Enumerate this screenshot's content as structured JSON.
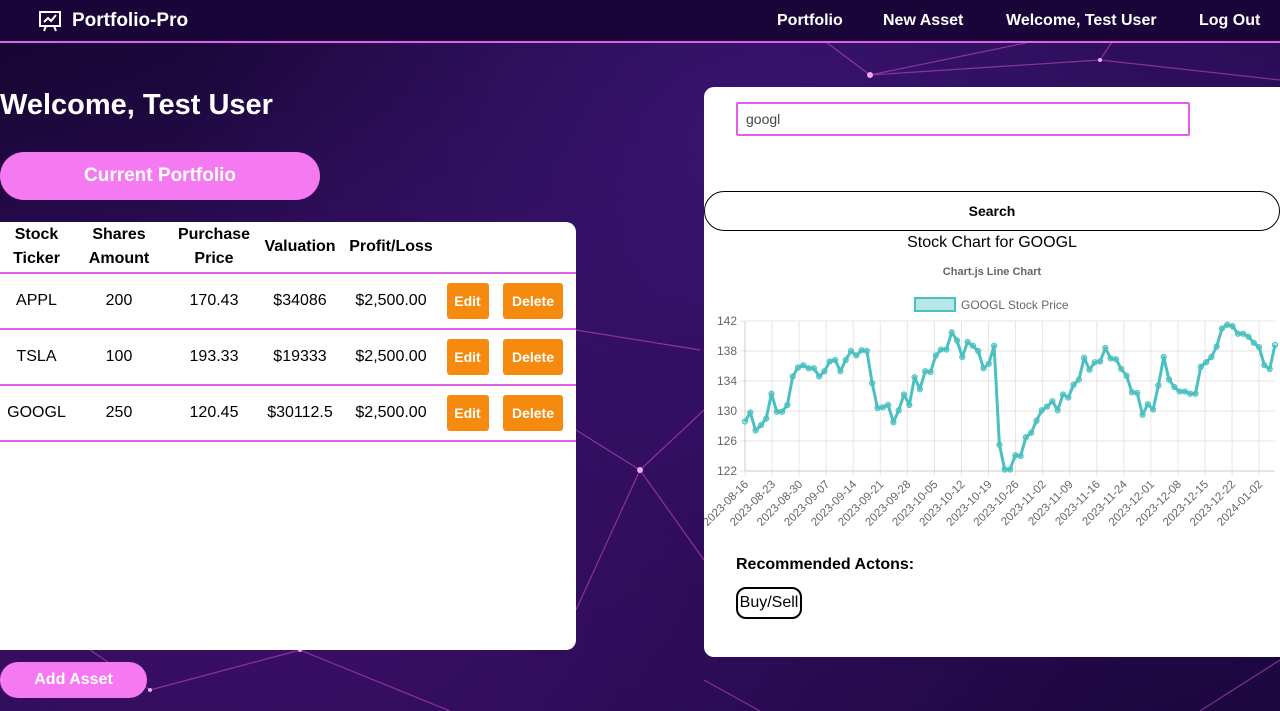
{
  "nav": {
    "brand": "Portfolio-Pro",
    "links": [
      "Portfolio",
      "New Asset",
      "Welcome, Test User",
      "Log Out"
    ]
  },
  "main": {
    "welcome": "Welcome, Test User",
    "current_portfolio_button": "Current Portfolio",
    "add_asset_button": "Add Asset"
  },
  "table": {
    "headers": [
      [
        "Stock",
        "Ticker"
      ],
      [
        "Shares",
        "Amount"
      ],
      [
        "Purchase",
        "Price"
      ],
      [
        "Valuation"
      ],
      [
        "Profit/Loss"
      ]
    ],
    "rows": [
      {
        "ticker": "APPL",
        "shares": "200",
        "price": "170.43",
        "valuation": "$34086",
        "pl": "$2,500.00",
        "edit": "Edit",
        "delete": "Delete"
      },
      {
        "ticker": "TSLA",
        "shares": "100",
        "price": "193.33",
        "valuation": "$19333",
        "pl": "$2,500.00",
        "edit": "Edit",
        "delete": "Delete"
      },
      {
        "ticker": "GOOGL",
        "shares": "250",
        "price": "120.45",
        "valuation": "$30112.5",
        "pl": "$2,500.00",
        "edit": "Edit",
        "delete": "Delete"
      }
    ]
  },
  "search": {
    "value": "googl",
    "button": "Search"
  },
  "chart_header": "Stock Chart for GOOGL",
  "recommended": {
    "label": "Recommended Actons:",
    "button": "Buy/Sell"
  },
  "colors": {
    "accent": "#e35ee6",
    "pill": "#f57af2",
    "orange": "#f58a0f",
    "line": "#4bc0c0"
  },
  "chart_data": {
    "type": "line",
    "title": "Chart.js Line Chart",
    "series": [
      {
        "name": "GOOGL Stock Price",
        "values": [
          128.6,
          129.8,
          127.4,
          128.1,
          129,
          132.3,
          129.9,
          129.9,
          130.8,
          134.6,
          135.8,
          136.1,
          135.7,
          135.7,
          134.6,
          135.3,
          136.6,
          136.8,
          135.3,
          136.8,
          138,
          137.4,
          138.1,
          138,
          133.7,
          130.4,
          130.5,
          130.8,
          128.5,
          130.1,
          132.2,
          130.8,
          134.5,
          132.9,
          135.3,
          135.2,
          137.4,
          138.2,
          138.2,
          140.5,
          139.4,
          137.2,
          139.2,
          138.7,
          138,
          135.7,
          136.3,
          138.7,
          125.5,
          122.2,
          122.2,
          124.1,
          124,
          126.5,
          127.1,
          128.7,
          130.1,
          130.6,
          131.3,
          130.1,
          132.2,
          131.8,
          133.5,
          134.2,
          137.1,
          135.5,
          136.5,
          136.6,
          138.4,
          137,
          136.9,
          135.6,
          134.7,
          132.5,
          132.4,
          129.5,
          130.9,
          130.2,
          133.4,
          137.2,
          134.2,
          133.2,
          132.6,
          132.6,
          132.3,
          132.3,
          135.9,
          136.5,
          137.2,
          138.6,
          141,
          141.5,
          141.3,
          140.3,
          140.3,
          139.9,
          139.1,
          138.5,
          136.1,
          135.6,
          138.8
        ]
      }
    ],
    "x_ticks": [
      "2023-08-16",
      "2023-08-23",
      "2023-08-30",
      "2023-09-07",
      "2023-09-14",
      "2023-09-21",
      "2023-09-28",
      "2023-10-05",
      "2023-10-12",
      "2023-10-19",
      "2023-10-26",
      "2023-11-02",
      "2023-11-09",
      "2023-11-16",
      "2023-11-24",
      "2023-12-01",
      "2023-12-08",
      "2023-12-15",
      "2023-12-22",
      "2024-01-02"
    ],
    "y_ticks": [
      142,
      138,
      134,
      130,
      126,
      122
    ],
    "ylim": [
      122,
      142
    ],
    "grid": true,
    "legend": "top"
  }
}
